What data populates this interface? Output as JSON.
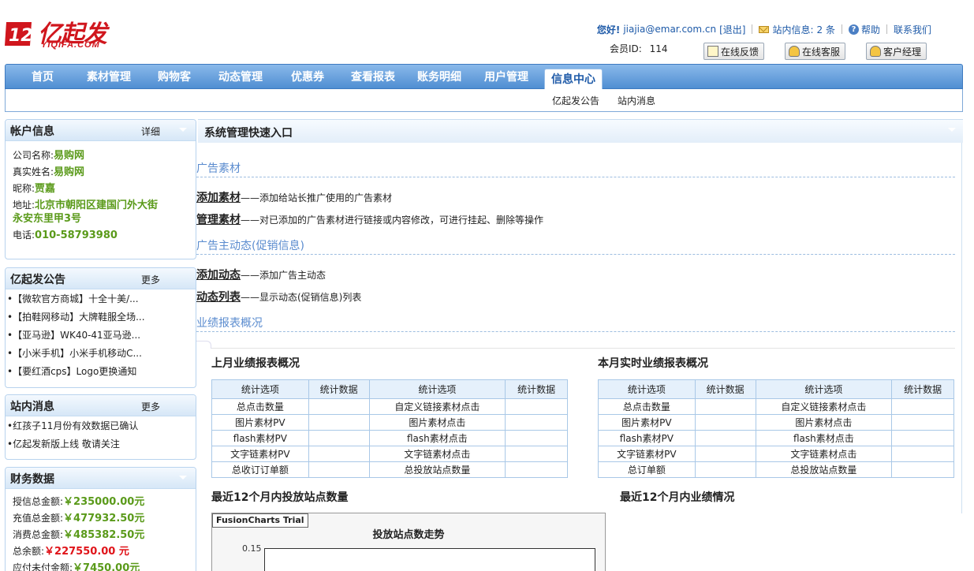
{
  "brand": {
    "name": "亿起发",
    "sub": "YIQIFA.COM"
  },
  "topbar": {
    "greeting": "您好!",
    "user": "jiajia@emar.com.cn",
    "logout": "[退出]",
    "messages_label": "站内信息:",
    "messages_count": "2 条",
    "help": "帮助",
    "contact": "联系我们"
  },
  "member": {
    "label": "会员ID:",
    "value": "114"
  },
  "buttons": {
    "feedback": "在线反馈",
    "service": "在线客服",
    "manager": "客户经理"
  },
  "nav": [
    "首页",
    "素材管理",
    "购物客",
    "动态管理",
    "优惠券",
    "查看报表",
    "账务明细",
    "用户管理",
    "信息中心"
  ],
  "subnav": [
    "亿起发公告",
    "站内消息"
  ],
  "account": {
    "title": "帐户信息",
    "more": "详细",
    "company_label": "公司名称:",
    "company": "易购网",
    "name_label": "真实姓名:",
    "name": "易购网",
    "nick_label": "昵称:",
    "nick": "贾嘉",
    "addr_label": "地址:",
    "addr1": "北京市朝阳区建国门外大街",
    "addr2": "永安东里甲3号",
    "phone_label": "电话:",
    "phone": "010-58793980"
  },
  "notice": {
    "title": "亿起发公告",
    "more": "更多",
    "items": [
      "•【微软官方商城】十全十美/...",
      "•【拍鞋网移动】大牌鞋服全场...",
      "•【亚马逊】WK40-41亚马逊...",
      "•【小米手机】小米手机移动C...",
      "•【要红酒cps】Logo更换通知"
    ]
  },
  "inbox": {
    "title": "站内消息",
    "more": "更多",
    "items": [
      "•红孩子11月份有效数据已确认",
      "•亿起发新版上线 敬请关注"
    ]
  },
  "finance": {
    "title": "财务数据",
    "credit_label": "授信总金额:",
    "credit": "￥235000.00元",
    "recharge_label": "充值总金额:",
    "recharge": "￥477932.50元",
    "spend_label": "消费总金额:",
    "spend": "￥485382.50元",
    "balance_label": "总余额:",
    "balance": "￥227550.00 元",
    "pending_label": "应付未付金额:",
    "pending": "￥7450.00元"
  },
  "main": {
    "title": "系统管理快速入口",
    "sec1": "广告素材",
    "add_material": "添加素材",
    "add_material_desc": "——添加给站长推广使用的广告素材",
    "manage_material": "管理素材",
    "manage_material_desc": "——对已添加的广告素材进行链接或内容修改，可进行挂起、删除等操作",
    "sec2": "广告主动态(促销信息)",
    "add_news": "添加动态",
    "add_news_desc": "——添加广告主动态",
    "news_list": "动态列表",
    "news_list_desc": "——显示动态(促销信息)列表",
    "sec3": "业绩报表概况"
  },
  "report": {
    "last_title": "上月业绩报表概况",
    "this_title": "本月实时业绩报表概况",
    "headers": [
      "统计选项",
      "统计数据",
      "统计选项",
      "统计数据"
    ],
    "last_rows": [
      [
        "总点击数量",
        "",
        "自定义链接素材点击",
        ""
      ],
      [
        "图片素材PV",
        "",
        "图片素材点击",
        ""
      ],
      [
        "flash素材PV",
        "",
        "flash素材点击",
        ""
      ],
      [
        "文字链素材PV",
        "",
        "文字链素材点击",
        ""
      ],
      [
        "总收订订单额",
        "",
        "总投放站点数量",
        ""
      ]
    ],
    "this_rows": [
      [
        "总点击数量",
        "",
        "自定义链接素材点击",
        ""
      ],
      [
        "图片素材PV",
        "",
        "图片素材点击",
        ""
      ],
      [
        "flash素材PV",
        "",
        "flash素材点击",
        ""
      ],
      [
        "文字链素材PV",
        "",
        "文字链素材点击",
        ""
      ],
      [
        "总订单额",
        "",
        "总投放站点数量",
        ""
      ]
    ],
    "sites_title": "最近12个月内投放站点数量",
    "perf_title": "最近12个月内业绩情况"
  },
  "chart_data": {
    "type": "line",
    "badge": "FusionCharts Trial",
    "title": "投放站点数走势",
    "yticks": [
      "0.15"
    ]
  }
}
